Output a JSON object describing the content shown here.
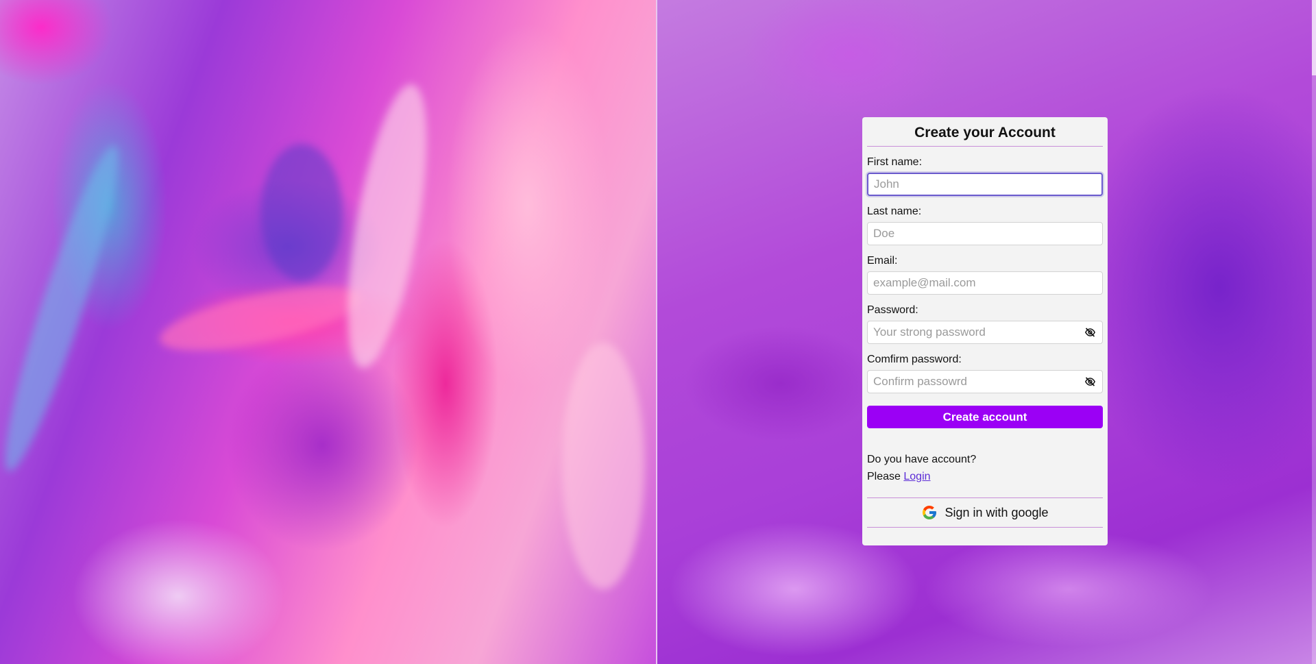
{
  "form": {
    "title": "Create your Account",
    "first_name": {
      "label": "First name:",
      "placeholder": "John",
      "value": ""
    },
    "last_name": {
      "label": "Last name:",
      "placeholder": "Doe",
      "value": ""
    },
    "email": {
      "label": "Email:",
      "placeholder": "example@mail.com",
      "value": ""
    },
    "password": {
      "label": "Password:",
      "placeholder": "Your strong password",
      "value": ""
    },
    "confirm_password": {
      "label": "Comfirm password:",
      "placeholder": "Confirm passowrd",
      "value": ""
    },
    "submit_label": "Create account",
    "login_prompt": "Do you have account?",
    "login_prefix": "Please",
    "login_link": "Login",
    "google_label": "Sign in with google",
    "password_toggle_icon": "eye-off-icon",
    "google_icon": "google-icon"
  },
  "colors": {
    "accent": "#9b00f5",
    "card_background": "#f3f3f3",
    "rule": "#c88ed8",
    "link": "#5b2bd6",
    "focus_ring": "#6a5acd"
  }
}
